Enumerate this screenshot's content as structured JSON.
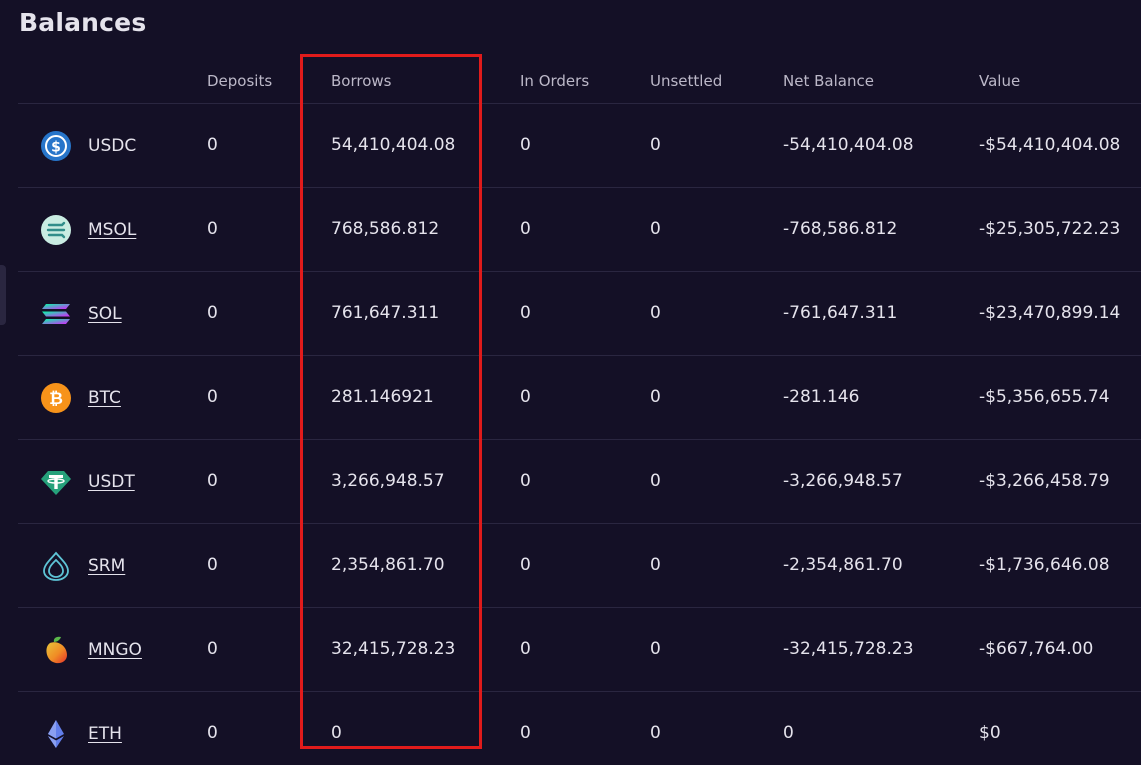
{
  "title": "Balances",
  "columns": {
    "deposits": "Deposits",
    "borrows": "Borrows",
    "in_orders": "In Orders",
    "unsettled": "Unsettled",
    "net_balance": "Net Balance",
    "value": "Value"
  },
  "rows": [
    {
      "asset": "USDC",
      "icon": "usdc-icon",
      "deposits": "0",
      "borrows": "54,410,404.08",
      "in_orders": "0",
      "unsettled": "0",
      "net_balance": "-54,410,404.08",
      "value": "-$54,410,404.08"
    },
    {
      "asset": "MSOL",
      "icon": "msol-icon",
      "deposits": "0",
      "borrows": "768,586.812",
      "in_orders": "0",
      "unsettled": "0",
      "net_balance": "-768,586.812",
      "value": "-$25,305,722.23"
    },
    {
      "asset": "SOL",
      "icon": "sol-icon",
      "deposits": "0",
      "borrows": "761,647.311",
      "in_orders": "0",
      "unsettled": "0",
      "net_balance": "-761,647.311",
      "value": "-$23,470,899.14"
    },
    {
      "asset": "BTC",
      "icon": "btc-icon",
      "deposits": "0",
      "borrows": "281.146921",
      "in_orders": "0",
      "unsettled": "0",
      "net_balance": "-281.146",
      "value": "-$5,356,655.74"
    },
    {
      "asset": "USDT",
      "icon": "usdt-icon",
      "deposits": "0",
      "borrows": "3,266,948.57",
      "in_orders": "0",
      "unsettled": "0",
      "net_balance": "-3,266,948.57",
      "value": "-$3,266,458.79"
    },
    {
      "asset": "SRM",
      "icon": "srm-icon",
      "deposits": "0",
      "borrows": "2,354,861.70",
      "in_orders": "0",
      "unsettled": "0",
      "net_balance": "-2,354,861.70",
      "value": "-$1,736,646.08"
    },
    {
      "asset": "MNGO",
      "icon": "mngo-icon",
      "deposits": "0",
      "borrows": "32,415,728.23",
      "in_orders": "0",
      "unsettled": "0",
      "net_balance": "-32,415,728.23",
      "value": "-$667,764.00"
    },
    {
      "asset": "ETH",
      "icon": "eth-icon",
      "deposits": "0",
      "borrows": "0",
      "in_orders": "0",
      "unsettled": "0",
      "net_balance": "0",
      "value": "$0"
    }
  ],
  "colors": {
    "background": "#141026",
    "text": "#e5e3ec",
    "header_text": "#bcb8c8",
    "divider": "#2a2640",
    "highlight": "#e01b1b"
  }
}
